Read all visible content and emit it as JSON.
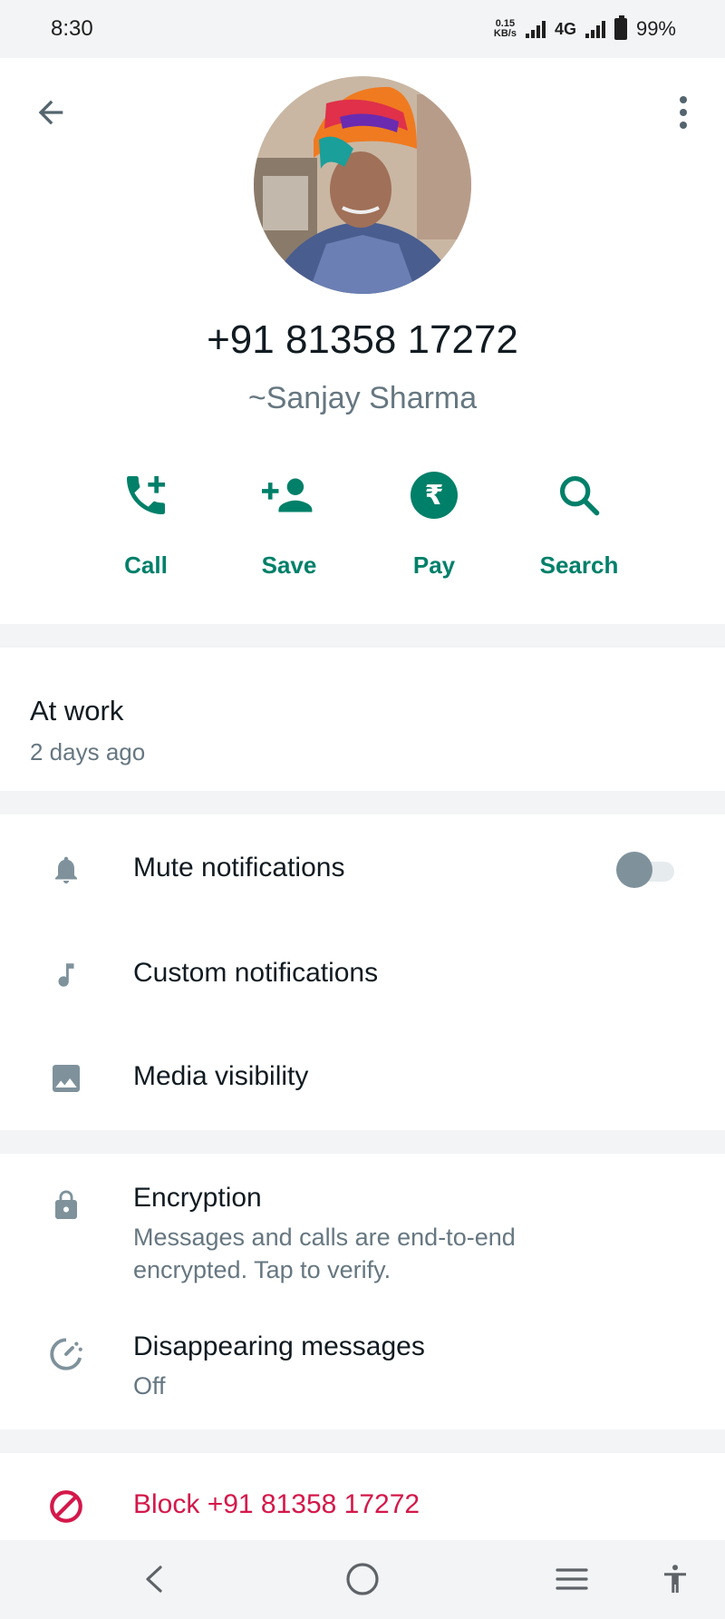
{
  "status_bar": {
    "time": "8:30",
    "net_speed_value": "0.15",
    "net_speed_unit": "KB/s",
    "network_type": "4G",
    "battery": "99%"
  },
  "header": {
    "phone_number": "+91 81358 17272",
    "display_name": "~Sanjay Sharma"
  },
  "actions": [
    {
      "label": "Call",
      "icon": "add-call-icon"
    },
    {
      "label": "Save",
      "icon": "add-person-icon"
    },
    {
      "label": "Pay",
      "icon": "rupee-icon"
    },
    {
      "label": "Search",
      "icon": "search-icon"
    }
  ],
  "about": {
    "text": "At work",
    "date": "2 days ago"
  },
  "settings": {
    "mute": {
      "label": "Mute notifications",
      "enabled": false
    },
    "custom": {
      "label": "Custom notifications"
    },
    "media": {
      "label": "Media visibility"
    }
  },
  "privacy": {
    "encryption": {
      "label": "Encryption",
      "sub_line1": "Messages and calls are end-to-end",
      "sub_line2": "encrypted. Tap to verify."
    },
    "disappearing": {
      "label": "Disappearing messages",
      "value": "Off"
    }
  },
  "block": {
    "label": "Block +91 81358 17272"
  },
  "colors": {
    "accent": "#008069",
    "danger": "#d4184a",
    "icon_gray": "#7f929c"
  }
}
